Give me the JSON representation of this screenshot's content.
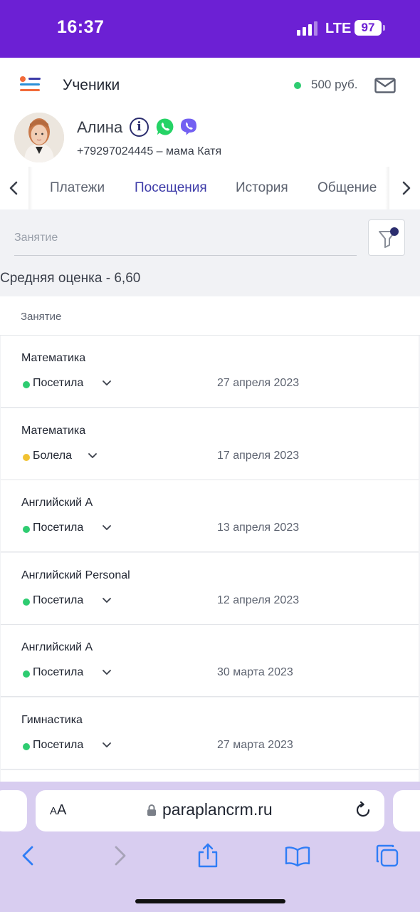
{
  "status_bar": {
    "time": "16:37",
    "network": "LTE",
    "battery": "97"
  },
  "header": {
    "title": "Ученики",
    "balance": "500 руб."
  },
  "student": {
    "name": "Алина",
    "phone": "+79297024445 – мама Катя"
  },
  "tabs": [
    {
      "label": "Платежи",
      "active": false
    },
    {
      "label": "Посещения",
      "active": true
    },
    {
      "label": "История",
      "active": false
    },
    {
      "label": "Общение",
      "active": false
    }
  ],
  "filter": {
    "lesson_placeholder": "Занятие",
    "average_score": "Средняя оценка - 6,60"
  },
  "table": {
    "column_header": "Занятие"
  },
  "attendance": [
    {
      "lesson": "Математика",
      "status": "Посетила",
      "status_color": "#2ecc71",
      "date": "27 апреля 2023"
    },
    {
      "lesson": "Математика",
      "status": "Болела",
      "status_color": "#f1c232",
      "date": "17 апреля 2023"
    },
    {
      "lesson": "Английский А",
      "status": "Посетила",
      "status_color": "#2ecc71",
      "date": "13 апреля 2023"
    },
    {
      "lesson": "Английский Personal",
      "status": "Посетила",
      "status_color": "#2ecc71",
      "date": "12 апреля 2023"
    },
    {
      "lesson": "Английский А",
      "status": "Посетила",
      "status_color": "#2ecc71",
      "date": "30 марта 2023"
    },
    {
      "lesson": "Гимнастика",
      "status": "Посетила",
      "status_color": "#2ecc71",
      "date": "27 марта 2023"
    }
  ],
  "browser": {
    "text_size_label": "AA",
    "url": "paraplancrm.ru"
  },
  "colors": {
    "brand_purple": "#6c20d4",
    "accent_indigo": "#3d3ba8",
    "safari_bar": "#d8cdf0",
    "ios_blue": "#2f7df6"
  },
  "icons": {
    "menu": "menu-icon",
    "mail": "mail-icon",
    "info": "info-icon",
    "whatsapp": "whatsapp-icon",
    "viber": "viber-icon",
    "filter": "filter-icon",
    "lock": "lock-icon",
    "reload": "reload-icon"
  }
}
